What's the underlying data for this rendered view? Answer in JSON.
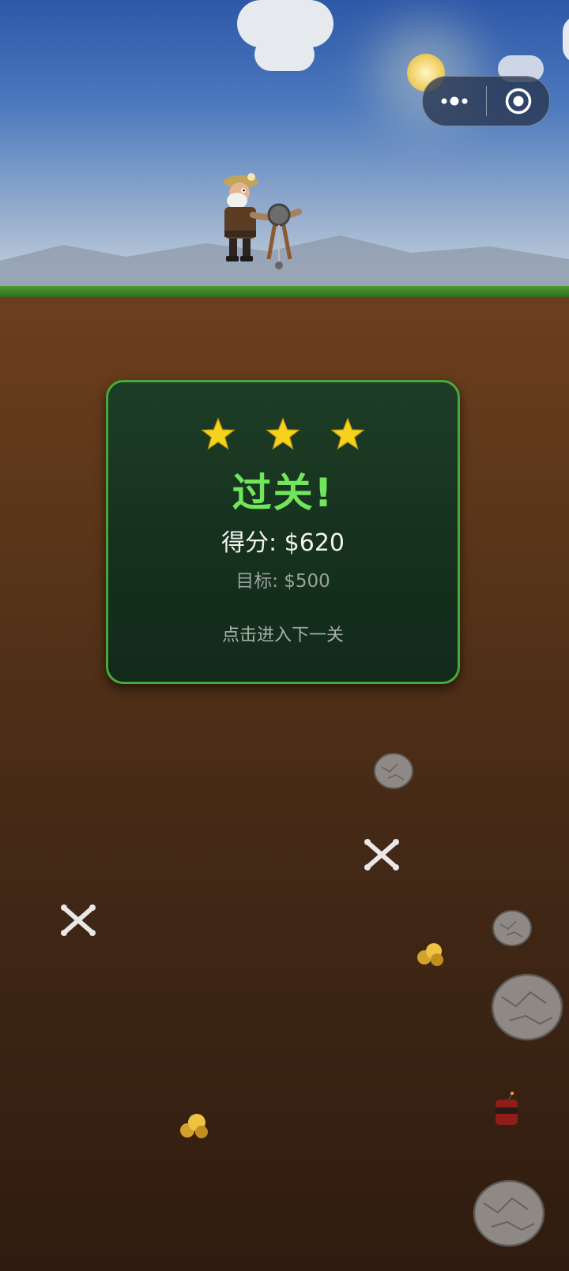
{
  "capsule": {
    "more_icon": "more-dots-icon",
    "close_icon": "target-close-icon"
  },
  "result": {
    "stars": 3,
    "title": "过关!",
    "score_label": "得分: $620",
    "target_label": "目标: $500",
    "next_label": "点击进入下一关"
  },
  "colors": {
    "panel_border": "#49a83a",
    "title_green": "#72e65a",
    "star_gold": "#f5d31c"
  },
  "field_items": [
    "rock",
    "bones",
    "bones",
    "rock",
    "gold-nugget",
    "rock",
    "dynamite-barrel",
    "gold-nugget",
    "rock"
  ]
}
